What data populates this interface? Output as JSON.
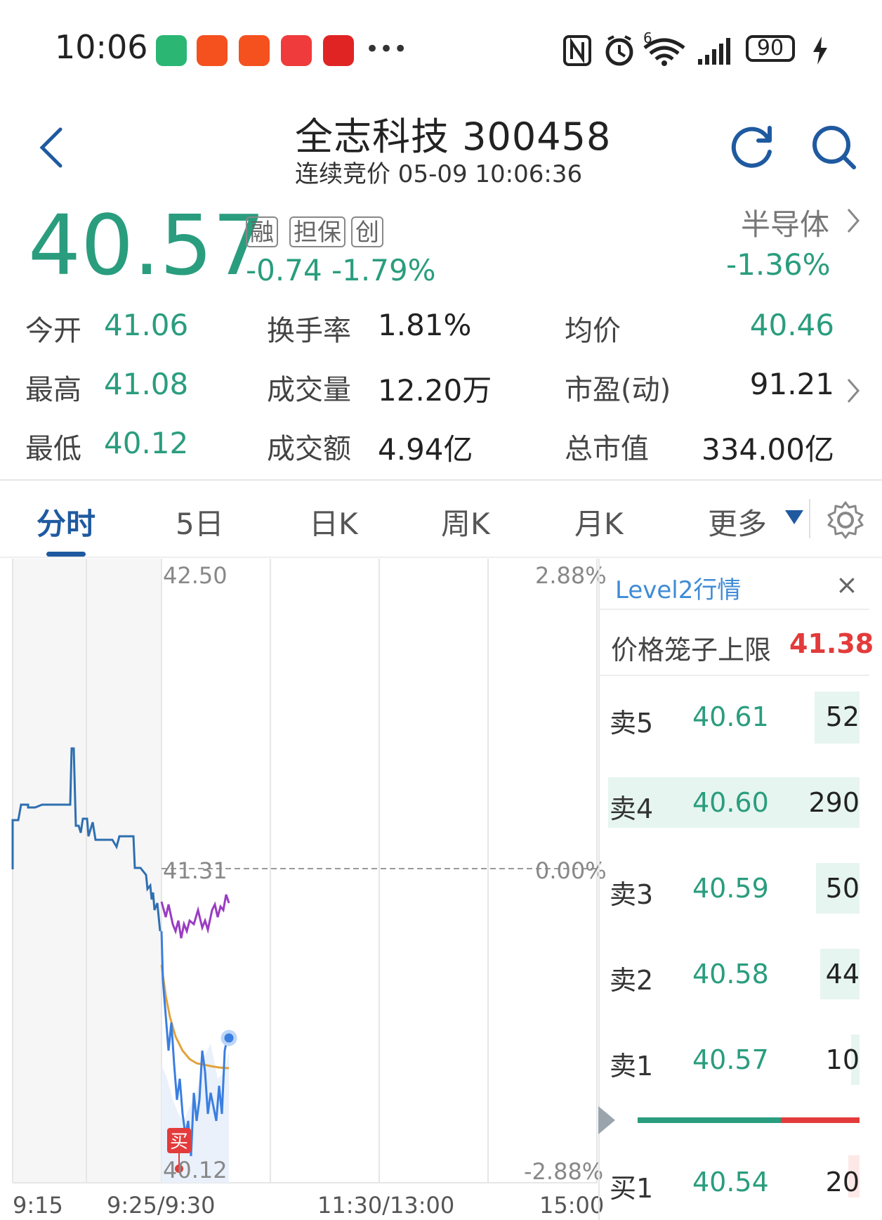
{
  "status_bar": {
    "time": "10:06",
    "battery": "90",
    "wifi_badge": "6",
    "app_icon_colors": [
      "#2bb673",
      "#f4511e",
      "#f4511e",
      "#ef3b3b",
      "#e02424"
    ]
  },
  "header": {
    "title": "全志科技 300458",
    "subtitle": "连续竞价 05-09 10:06:36"
  },
  "quote": {
    "price": "40.57",
    "change": "-0.74",
    "change_pct": "-1.79%",
    "tags": [
      "融",
      "担保",
      "创"
    ],
    "sector_name": "半导体",
    "sector_pct": "-1.36%"
  },
  "stats": [
    {
      "label": "今开",
      "value": "41.06"
    },
    {
      "label": "换手率",
      "value": "1.81%"
    },
    {
      "label": "均价",
      "value": "40.46"
    },
    {
      "label": "最高",
      "value": "41.08"
    },
    {
      "label": "成交量",
      "value": "12.20万"
    },
    {
      "label": "市盈(动)",
      "value": "91.21"
    },
    {
      "label": "最低",
      "value": "40.12"
    },
    {
      "label": "成交额",
      "value": "4.94亿"
    },
    {
      "label": "总市值",
      "value": "334.00亿"
    }
  ],
  "tabs": [
    "分时",
    "5日",
    "日K",
    "周K",
    "月K",
    "更多"
  ],
  "chart": {
    "price_top": "42.50",
    "price_mid": "41.31",
    "price_bottom": "40.12",
    "pct_top": "2.88%",
    "pct_mid": "0.00%",
    "pct_bottom": "-2.88%",
    "times": [
      "9:15",
      "9:25/9:30",
      "11:30/13:00",
      "15:00"
    ],
    "buy_marker": "买"
  },
  "level2": {
    "title": "Level2行情",
    "close": "×",
    "cage_label": "价格笼子上限",
    "cage_value": "41.38",
    "asks": [
      {
        "label": "卖5",
        "price": "40.61",
        "volume": "52"
      },
      {
        "label": "卖4",
        "price": "40.60",
        "volume": "290"
      },
      {
        "label": "卖3",
        "price": "40.59",
        "volume": "50"
      },
      {
        "label": "卖2",
        "price": "40.58",
        "volume": "44"
      },
      {
        "label": "卖1",
        "price": "40.57",
        "volume": "10"
      }
    ],
    "bids": [
      {
        "label": "买1",
        "price": "40.54",
        "volume": "20"
      }
    ]
  }
}
